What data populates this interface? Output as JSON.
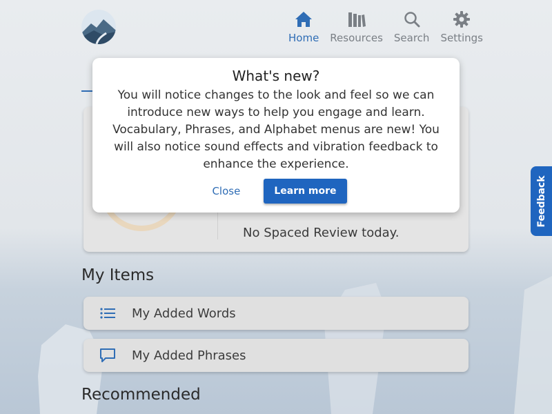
{
  "nav": {
    "items": [
      {
        "label": "Home",
        "icon": "home-icon",
        "active": true
      },
      {
        "label": "Resources",
        "icon": "books-icon",
        "active": false
      },
      {
        "label": "Search",
        "icon": "search-icon",
        "active": false
      },
      {
        "label": "Settings",
        "icon": "gear-icon",
        "active": false
      }
    ]
  },
  "review": {
    "status_text": "No Spaced Review today."
  },
  "my_items": {
    "title": "My Items",
    "items": [
      {
        "label": "My Added Words",
        "icon": "list-icon"
      },
      {
        "label": "My Added Phrases",
        "icon": "speech-bubble-icon"
      }
    ]
  },
  "recommended": {
    "title": "Recommended"
  },
  "dialog": {
    "title": "What's new?",
    "body_lines": [
      "You will notice changes to the look and feel so we can",
      "introduce new ways to help you engage and learn.",
      "Vocabulary, Phrases, and Alphabet menus are new! You",
      "will also notice sound effects and vibration feedback to",
      "enhance the experience."
    ],
    "close_label": "Close",
    "learn_more_label": "Learn more"
  },
  "feedback": {
    "label": "Feedback"
  },
  "colors": {
    "accent": "#1f65bf",
    "nav_active": "#2f6db5",
    "nav_inactive": "#7a7f85"
  }
}
